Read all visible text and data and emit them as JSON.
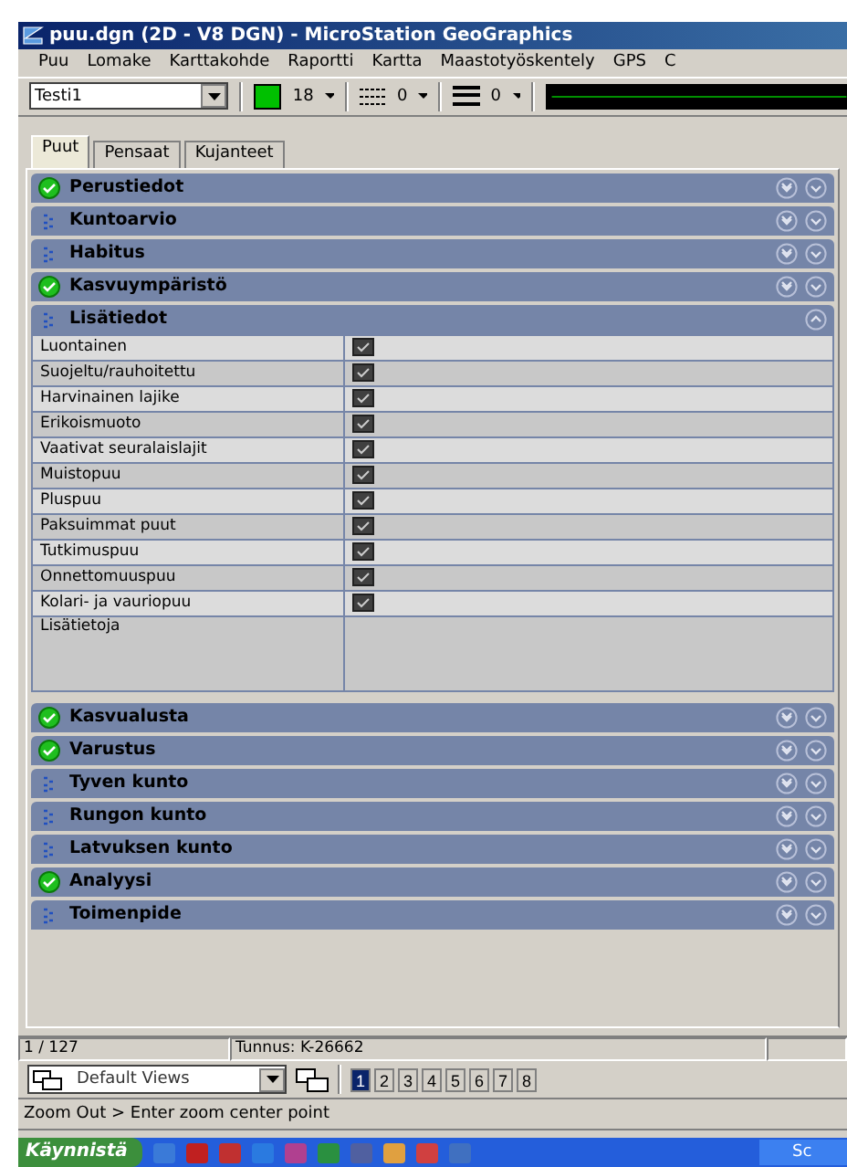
{
  "window": {
    "title": "puu.dgn (2D - V8 DGN) - MicroStation GeoGraphics"
  },
  "menu": [
    "Puu",
    "Lomake",
    "Karttakohde",
    "Raportti",
    "Kartta",
    "Maastotyöskentely",
    "GPS",
    "C"
  ],
  "toolbar": {
    "level_combo": "Testi1",
    "color": "#00c000",
    "color_number": "18",
    "style": "0",
    "weight": "0"
  },
  "tabs": [
    {
      "label": "Puut",
      "selected": true
    },
    {
      "label": "Pensaat",
      "selected": false
    },
    {
      "label": "Kujanteet",
      "selected": false
    }
  ],
  "sections_before": [
    {
      "title": "Perustiedot",
      "kind": "done",
      "expanded": false
    },
    {
      "title": "Kuntoarvio",
      "kind": "pending",
      "expanded": false
    },
    {
      "title": "Habitus",
      "kind": "pending",
      "expanded": false
    },
    {
      "title": "Kasvuympäristö",
      "kind": "done",
      "expanded": false
    },
    {
      "title": "Lisätiedot",
      "kind": "pending",
      "expanded": true
    }
  ],
  "fields": [
    {
      "label": "Luontainen",
      "checked": true
    },
    {
      "label": "Suojeltu/rauhoitettu",
      "checked": true
    },
    {
      "label": "Harvinainen lajike",
      "checked": true
    },
    {
      "label": "Erikoismuoto",
      "checked": true
    },
    {
      "label": "Vaativat seuralaislajit",
      "checked": true
    },
    {
      "label": "Muistopuu",
      "checked": true
    },
    {
      "label": "Pluspuu",
      "checked": true
    },
    {
      "label": "Paksuimmat puut",
      "checked": true
    },
    {
      "label": "Tutkimuspuu",
      "checked": true
    },
    {
      "label": "Onnettomuuspuu",
      "checked": true
    },
    {
      "label": "Kolari- ja vauriopuu",
      "checked": true
    }
  ],
  "notes_label": "Lisätietoja",
  "sections_after": [
    {
      "title": "Kasvualusta",
      "kind": "done",
      "expanded": false
    },
    {
      "title": "Varustus",
      "kind": "done",
      "expanded": false
    },
    {
      "title": "Tyven kunto",
      "kind": "pending",
      "expanded": false
    },
    {
      "title": "Rungon kunto",
      "kind": "pending",
      "expanded": false
    },
    {
      "title": "Latvuksen kunto",
      "kind": "pending",
      "expanded": false
    },
    {
      "title": "Analyysi",
      "kind": "done",
      "expanded": false
    },
    {
      "title": "Toimenpide",
      "kind": "pending",
      "expanded": false
    }
  ],
  "status_bar": {
    "count": "1 / 127",
    "id": "Tunnus: K-26662"
  },
  "views": {
    "combo": "Default Views",
    "buttons": [
      {
        "label": "1",
        "selected": true
      },
      {
        "label": "2",
        "selected": false
      },
      {
        "label": "3",
        "selected": false
      },
      {
        "label": "4",
        "selected": false
      },
      {
        "label": "5",
        "selected": false
      },
      {
        "label": "6",
        "selected": false
      },
      {
        "label": "7",
        "selected": false
      },
      {
        "label": "8",
        "selected": false
      }
    ]
  },
  "prompt": "Zoom Out > Enter zoom center point",
  "taskbar": {
    "start": "Käynnistä",
    "window": "Sc"
  }
}
